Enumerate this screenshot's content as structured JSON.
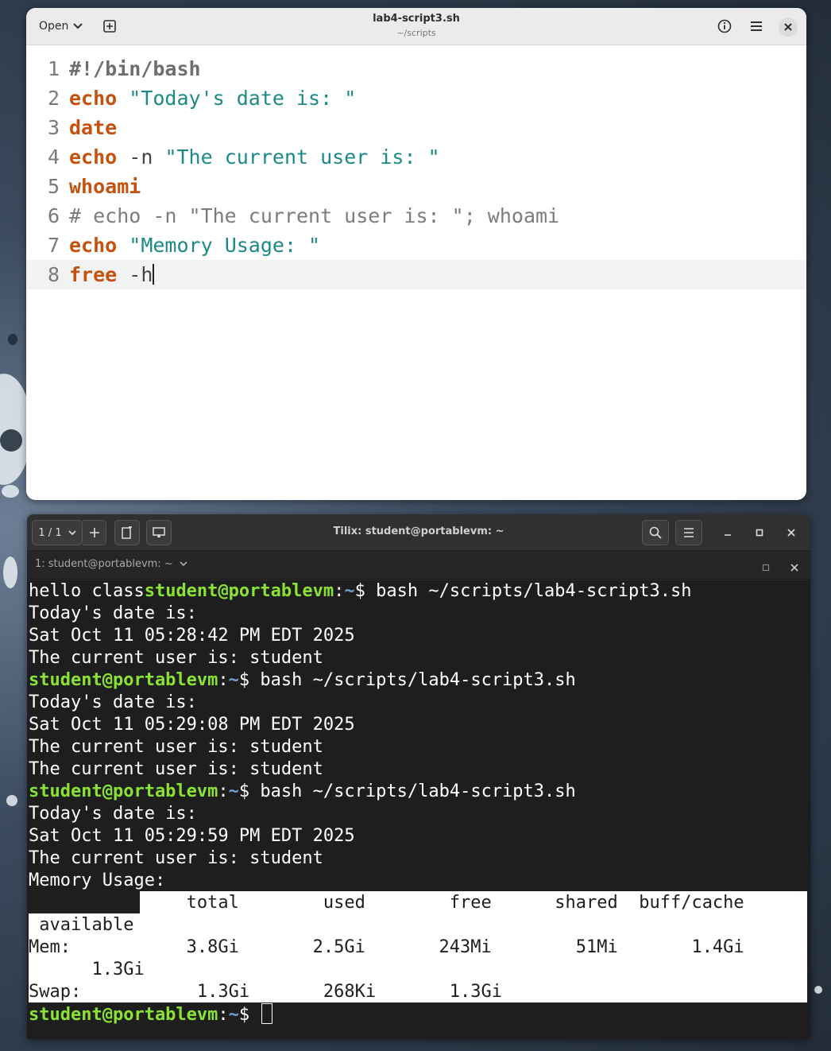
{
  "editor": {
    "open_label": "Open",
    "title": "lab4-script3.sh",
    "subtitle": "~/scripts",
    "lines": [
      {
        "num": "1",
        "parts": [
          {
            "t": "#!/bin/bash",
            "c": "shebang"
          }
        ]
      },
      {
        "num": "2",
        "parts": [
          {
            "t": "echo",
            "c": "kw"
          },
          {
            "t": " ",
            "c": "plain"
          },
          {
            "t": "\"Today's date is: \"",
            "c": "str"
          }
        ]
      },
      {
        "num": "3",
        "parts": [
          {
            "t": "date",
            "c": "kw"
          }
        ]
      },
      {
        "num": "4",
        "parts": [
          {
            "t": "echo",
            "c": "kw"
          },
          {
            "t": " -n ",
            "c": "plain"
          },
          {
            "t": "\"The current user is: \"",
            "c": "str"
          }
        ]
      },
      {
        "num": "5",
        "parts": [
          {
            "t": "whoami",
            "c": "kw"
          }
        ]
      },
      {
        "num": "6",
        "parts": [
          {
            "t": "# echo -n \"The current user is: \"; whoami",
            "c": "cm"
          }
        ]
      },
      {
        "num": "7",
        "parts": [
          {
            "t": "echo",
            "c": "kw"
          },
          {
            "t": " ",
            "c": "plain"
          },
          {
            "t": "\"Memory Usage: \"",
            "c": "str"
          }
        ]
      },
      {
        "num": "8",
        "parts": [
          {
            "t": "free",
            "c": "kw"
          },
          {
            "t": " -h",
            "c": "plain"
          }
        ],
        "current": true
      }
    ]
  },
  "terminal": {
    "tab_counter": "1 / 1",
    "title": "Tilix: student@portablevm: ~",
    "session_tab": "1: student@portablevm: ~",
    "prompt_user": "student@portablevm",
    "prompt_colon": ":",
    "prompt_path": "~",
    "prompt_dollar": "$ ",
    "command": "bash ~/scripts/lab4-script3.sh",
    "first_prefix": "hello class",
    "out_date_label": "Today's date is:",
    "out_date1": "Sat Oct 11 05:28:42 PM EDT 2025",
    "out_date2": "Sat Oct 11 05:29:08 PM EDT 2025",
    "out_date3": "Sat Oct 11 05:29:59 PM EDT 2025",
    "out_user": "The current user is: student",
    "out_memory": "Memory Usage:",
    "free_header": "               total        used        free      shared  buff/cache",
    "free_header2": " available",
    "free_mem": "Mem:           3.8Gi       2.5Gi       243Mi        51Mi       1.4Gi",
    "free_mem2": "      1.3Gi",
    "free_swap": "Swap:           1.3Gi       268Ki       1.3Gi"
  }
}
